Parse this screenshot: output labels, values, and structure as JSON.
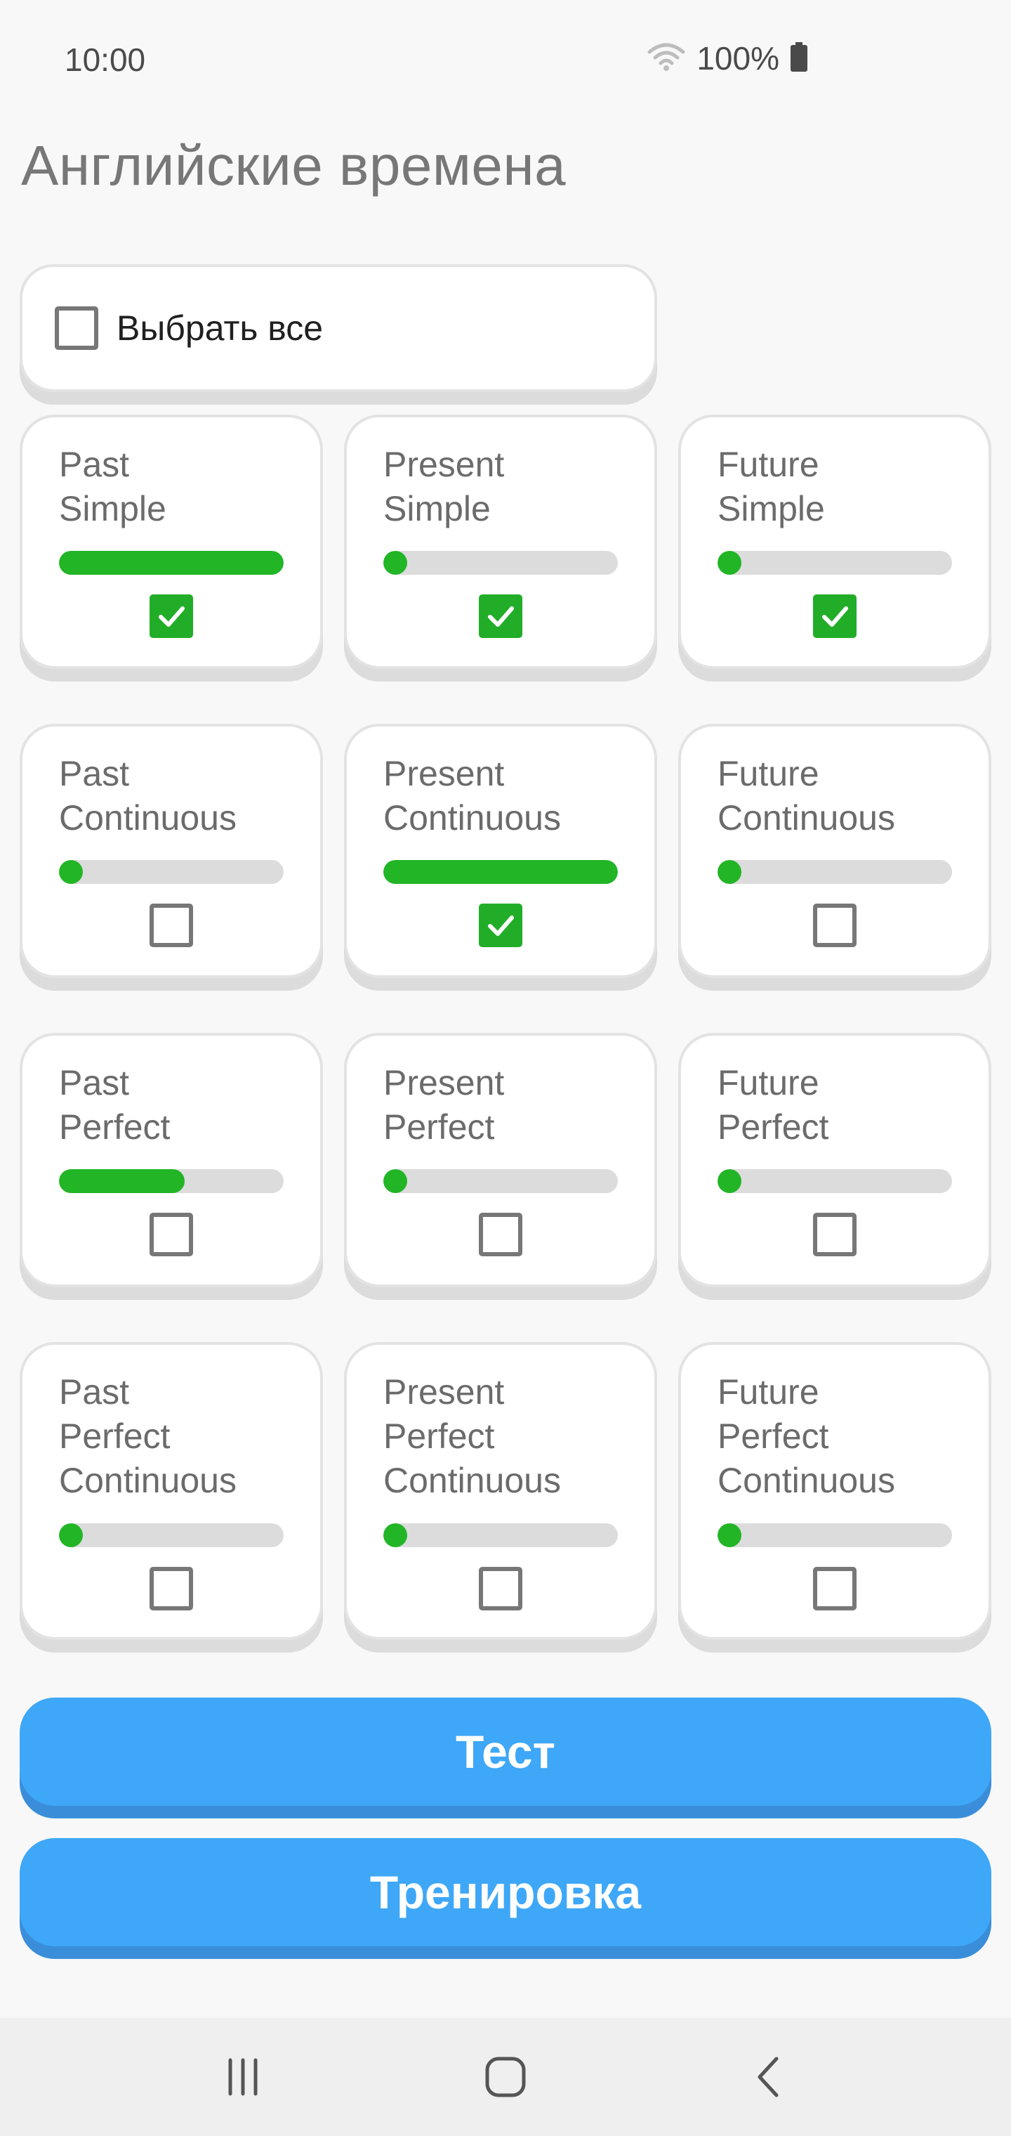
{
  "status_bar": {
    "time": "10:00",
    "battery": "100%"
  },
  "page": {
    "title": "Английские времена"
  },
  "select_all": {
    "label": "Выбрать все",
    "checked": false
  },
  "tenses": [
    {
      "id": "past-simple",
      "name": "Past\nSimple",
      "progress": 1.0,
      "checked": true
    },
    {
      "id": "present-simple",
      "name": "Present\nSimple",
      "progress": 0.0,
      "checked": true
    },
    {
      "id": "future-simple",
      "name": "Future\nSimple",
      "progress": 0.0,
      "checked": true
    },
    {
      "id": "past-continuous",
      "name": "Past\nContinuous",
      "progress": 0.0,
      "checked": false
    },
    {
      "id": "present-continuous",
      "name": "Present\nContinuous",
      "progress": 1.0,
      "checked": true
    },
    {
      "id": "future-continuous",
      "name": "Future\nContinuous",
      "progress": 0.0,
      "checked": false
    },
    {
      "id": "past-perfect",
      "name": "Past\nPerfect",
      "progress": 0.56,
      "checked": false
    },
    {
      "id": "present-perfect",
      "name": "Present\nPerfect",
      "progress": 0.0,
      "checked": false
    },
    {
      "id": "future-perfect",
      "name": "Future\nPerfect",
      "progress": 0.0,
      "checked": false
    },
    {
      "id": "past-perfect-continuous",
      "name": "Past\nPerfect\nContinuous",
      "progress": 0.0,
      "checked": false
    },
    {
      "id": "present-perfect-continuous",
      "name": "Present\nPerfect\nContinuous",
      "progress": 0.0,
      "checked": false
    },
    {
      "id": "future-perfect-continuous",
      "name": "Future\nPerfect\nContinuous",
      "progress": 0.0,
      "checked": false
    }
  ],
  "buttons": {
    "test": "Тест",
    "training": "Тренировка"
  },
  "colors": {
    "accent_green": "#22b526",
    "button_blue": "#3fa7f7"
  }
}
